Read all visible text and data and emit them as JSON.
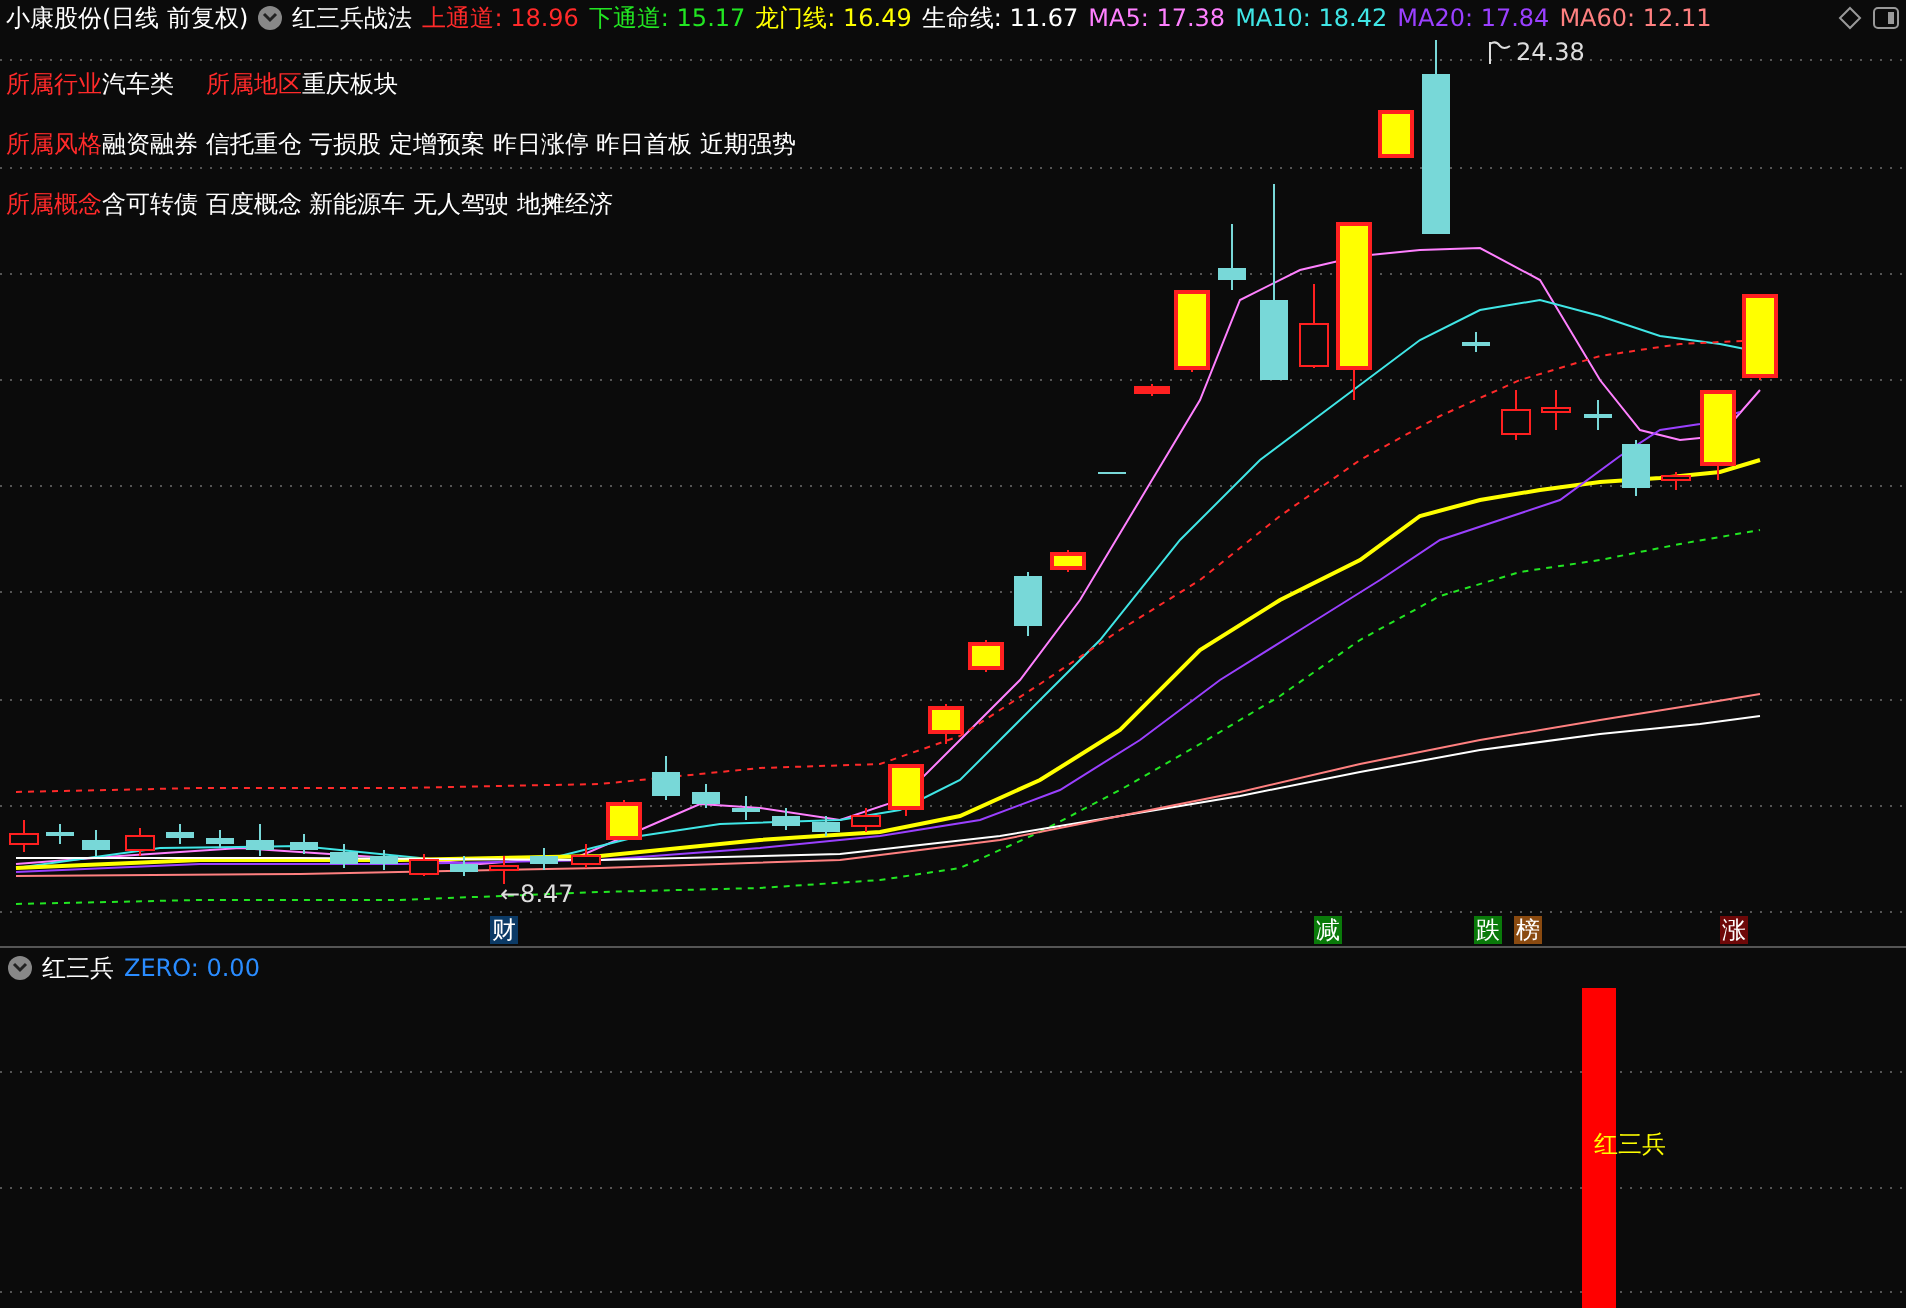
{
  "header": {
    "title": "小康股份(日线 前复权)",
    "indicator": "红三兵战法",
    "readings": [
      {
        "label": "上通道:",
        "value": "18.96",
        "color": "#ff2a2a"
      },
      {
        "label": "下通道:",
        "value": "15.17",
        "color": "#22e622"
      },
      {
        "label": "龙门线:",
        "value": "16.49",
        "color": "#ffff00"
      },
      {
        "label": "生命线:",
        "value": "11.67",
        "color": "#ffffff"
      },
      {
        "label": "MA5:",
        "value": "17.38",
        "color": "#ff80ff"
      },
      {
        "label": "MA10:",
        "value": "18.42",
        "color": "#40e6e6"
      },
      {
        "label": "MA20:",
        "value": "17.84",
        "color": "#9a40ff"
      },
      {
        "label": "MA60:",
        "value": "12.11",
        "color": "#ff8080"
      }
    ]
  },
  "info_lines": [
    {
      "items": [
        {
          "label": "所属行业",
          "text": "汽车类"
        },
        {
          "label": "所属地区",
          "text": "重庆板块"
        }
      ]
    },
    {
      "items": [
        {
          "label": "所属风格",
          "text": "融资融券 信托重仓 亏损股 定增预案 昨日涨停 昨日首板 近期强势"
        }
      ]
    },
    {
      "items": [
        {
          "label": "所属概念",
          "text": "含可转债 百度概念 新能源车 无人驾驶 地摊经济"
        }
      ]
    }
  ],
  "chart_labels": {
    "high": "24.38",
    "low": "←8.47"
  },
  "markers": [
    {
      "text": "财",
      "color": "#0b3a66"
    },
    {
      "text": "减",
      "color": "#0a7a0a"
    },
    {
      "text": "跌",
      "color": "#0a7a0a"
    },
    {
      "text": "榜",
      "color": "#8a4a10"
    },
    {
      "text": "涨",
      "color": "#6e0808"
    }
  ],
  "lower_panel": {
    "title": "红三兵",
    "zero": "ZERO: 0.00",
    "signal_label": "红三兵"
  }
}
